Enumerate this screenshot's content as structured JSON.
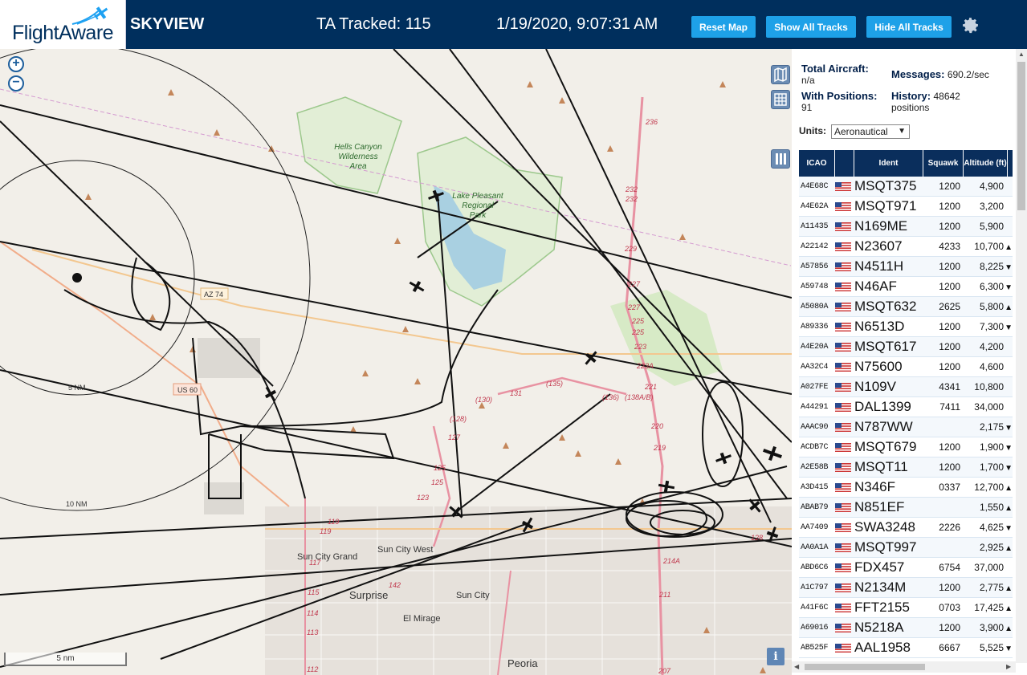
{
  "header": {
    "logo_text": "FlightAware",
    "app_title": "SKYVIEW",
    "tracked_text": "TA Tracked: 115",
    "datetime": "1/19/2020, 9:07:31 AM",
    "buttons": {
      "reset_map": "Reset Map",
      "show_all_tracks": "Show All Tracks",
      "hide_all_tracks": "Hide All Tracks"
    },
    "settings_icon": "gear-icon"
  },
  "map": {
    "zoom_in": "+",
    "zoom_out": "−",
    "scale_label": "5 nm",
    "info_button": "i",
    "range_ring_labels": [
      "5 NM",
      "10 NM"
    ],
    "place_labels": [
      "Hells Canyon Wilderness Area",
      "Lake Pleasant Regional Park",
      "Sun City Grand",
      "Sun City West",
      "Surprise",
      "Sun City",
      "El Mirage",
      "Peoria"
    ],
    "road_labels": [
      "AZ 74",
      "US 60",
      "236",
      "232",
      "232",
      "229",
      "227",
      "225",
      "225",
      "223",
      "223A",
      "221",
      "220",
      "219",
      "217",
      "214A",
      "211",
      "207",
      "131",
      "(135)",
      "(130)",
      "(128)",
      "127",
      "125",
      "125",
      "123",
      "119",
      "119",
      "117",
      "115",
      "114",
      "113",
      "112",
      "142",
      "(136)",
      "(138A/B)",
      "128"
    ]
  },
  "panel": {
    "total_aircraft_label": "Total Aircraft:",
    "total_aircraft_value": "n/a",
    "with_positions_label": "With Positions:",
    "with_positions_value": "91",
    "messages_label": "Messages:",
    "messages_value": "690.2/sec",
    "history_label": "History:",
    "history_value": "48642 positions",
    "units_label": "Units:",
    "units_value": "Aeronautical",
    "columns": {
      "icao": "ICAO",
      "ident": "Ident",
      "squawk": "Squawk",
      "altitude": "Altitude (ft)"
    },
    "rows": [
      {
        "icao": "A4E68C",
        "ident": "MSQT375",
        "squawk": "1200",
        "alt": "4,900",
        "trend": ""
      },
      {
        "icao": "A4E62A",
        "ident": "MSQT971",
        "squawk": "1200",
        "alt": "3,200",
        "trend": ""
      },
      {
        "icao": "A11435",
        "ident": "N169ME",
        "squawk": "1200",
        "alt": "5,900",
        "trend": ""
      },
      {
        "icao": "A22142",
        "ident": "N23607",
        "squawk": "4233",
        "alt": "10,700",
        "trend": "▲"
      },
      {
        "icao": "A57856",
        "ident": "N4511H",
        "squawk": "1200",
        "alt": "8,225",
        "trend": "▼"
      },
      {
        "icao": "A59748",
        "ident": "N46AF",
        "squawk": "1200",
        "alt": "6,300",
        "trend": "▼"
      },
      {
        "icao": "A5080A",
        "ident": "MSQT632",
        "squawk": "2625",
        "alt": "5,800",
        "trend": "▲"
      },
      {
        "icao": "A89336",
        "ident": "N6513D",
        "squawk": "1200",
        "alt": "7,300",
        "trend": "▼"
      },
      {
        "icao": "A4E20A",
        "ident": "MSQT617",
        "squawk": "1200",
        "alt": "4,200",
        "trend": ""
      },
      {
        "icao": "AA32C4",
        "ident": "N75600",
        "squawk": "1200",
        "alt": "4,600",
        "trend": ""
      },
      {
        "icao": "A027FE",
        "ident": "N109V",
        "squawk": "4341",
        "alt": "10,800",
        "trend": ""
      },
      {
        "icao": "A44291",
        "ident": "DAL1399",
        "squawk": "7411",
        "alt": "34,000",
        "trend": ""
      },
      {
        "icao": "AAAC90",
        "ident": "N787WW",
        "squawk": "",
        "alt": "2,175",
        "trend": "▼"
      },
      {
        "icao": "ACDB7C",
        "ident": "MSQT679",
        "squawk": "1200",
        "alt": "1,900",
        "trend": "▼"
      },
      {
        "icao": "A2E58B",
        "ident": "MSQT11",
        "squawk": "1200",
        "alt": "1,700",
        "trend": "▼"
      },
      {
        "icao": "A3D415",
        "ident": "N346F",
        "squawk": "0337",
        "alt": "12,700",
        "trend": "▲"
      },
      {
        "icao": "ABAB79",
        "ident": "N851EF",
        "squawk": "",
        "alt": "1,550",
        "trend": "▲"
      },
      {
        "icao": "AA7409",
        "ident": "SWA3248",
        "squawk": "2226",
        "alt": "4,625",
        "trend": "▼"
      },
      {
        "icao": "AA0A1A",
        "ident": "MSQT997",
        "squawk": "",
        "alt": "2,925",
        "trend": "▲"
      },
      {
        "icao": "ABD6C6",
        "ident": "FDX457",
        "squawk": "6754",
        "alt": "37,000",
        "trend": ""
      },
      {
        "icao": "A1C797",
        "ident": "N2134M",
        "squawk": "1200",
        "alt": "2,775",
        "trend": "▲"
      },
      {
        "icao": "A41F6C",
        "ident": "FFT2155",
        "squawk": "0703",
        "alt": "17,425",
        "trend": "▲"
      },
      {
        "icao": "A69016",
        "ident": "N5218A",
        "squawk": "1200",
        "alt": "3,900",
        "trend": "▲"
      },
      {
        "icao": "AB525F",
        "ident": "AAL1958",
        "squawk": "6667",
        "alt": "5,525",
        "trend": "▼"
      }
    ]
  }
}
